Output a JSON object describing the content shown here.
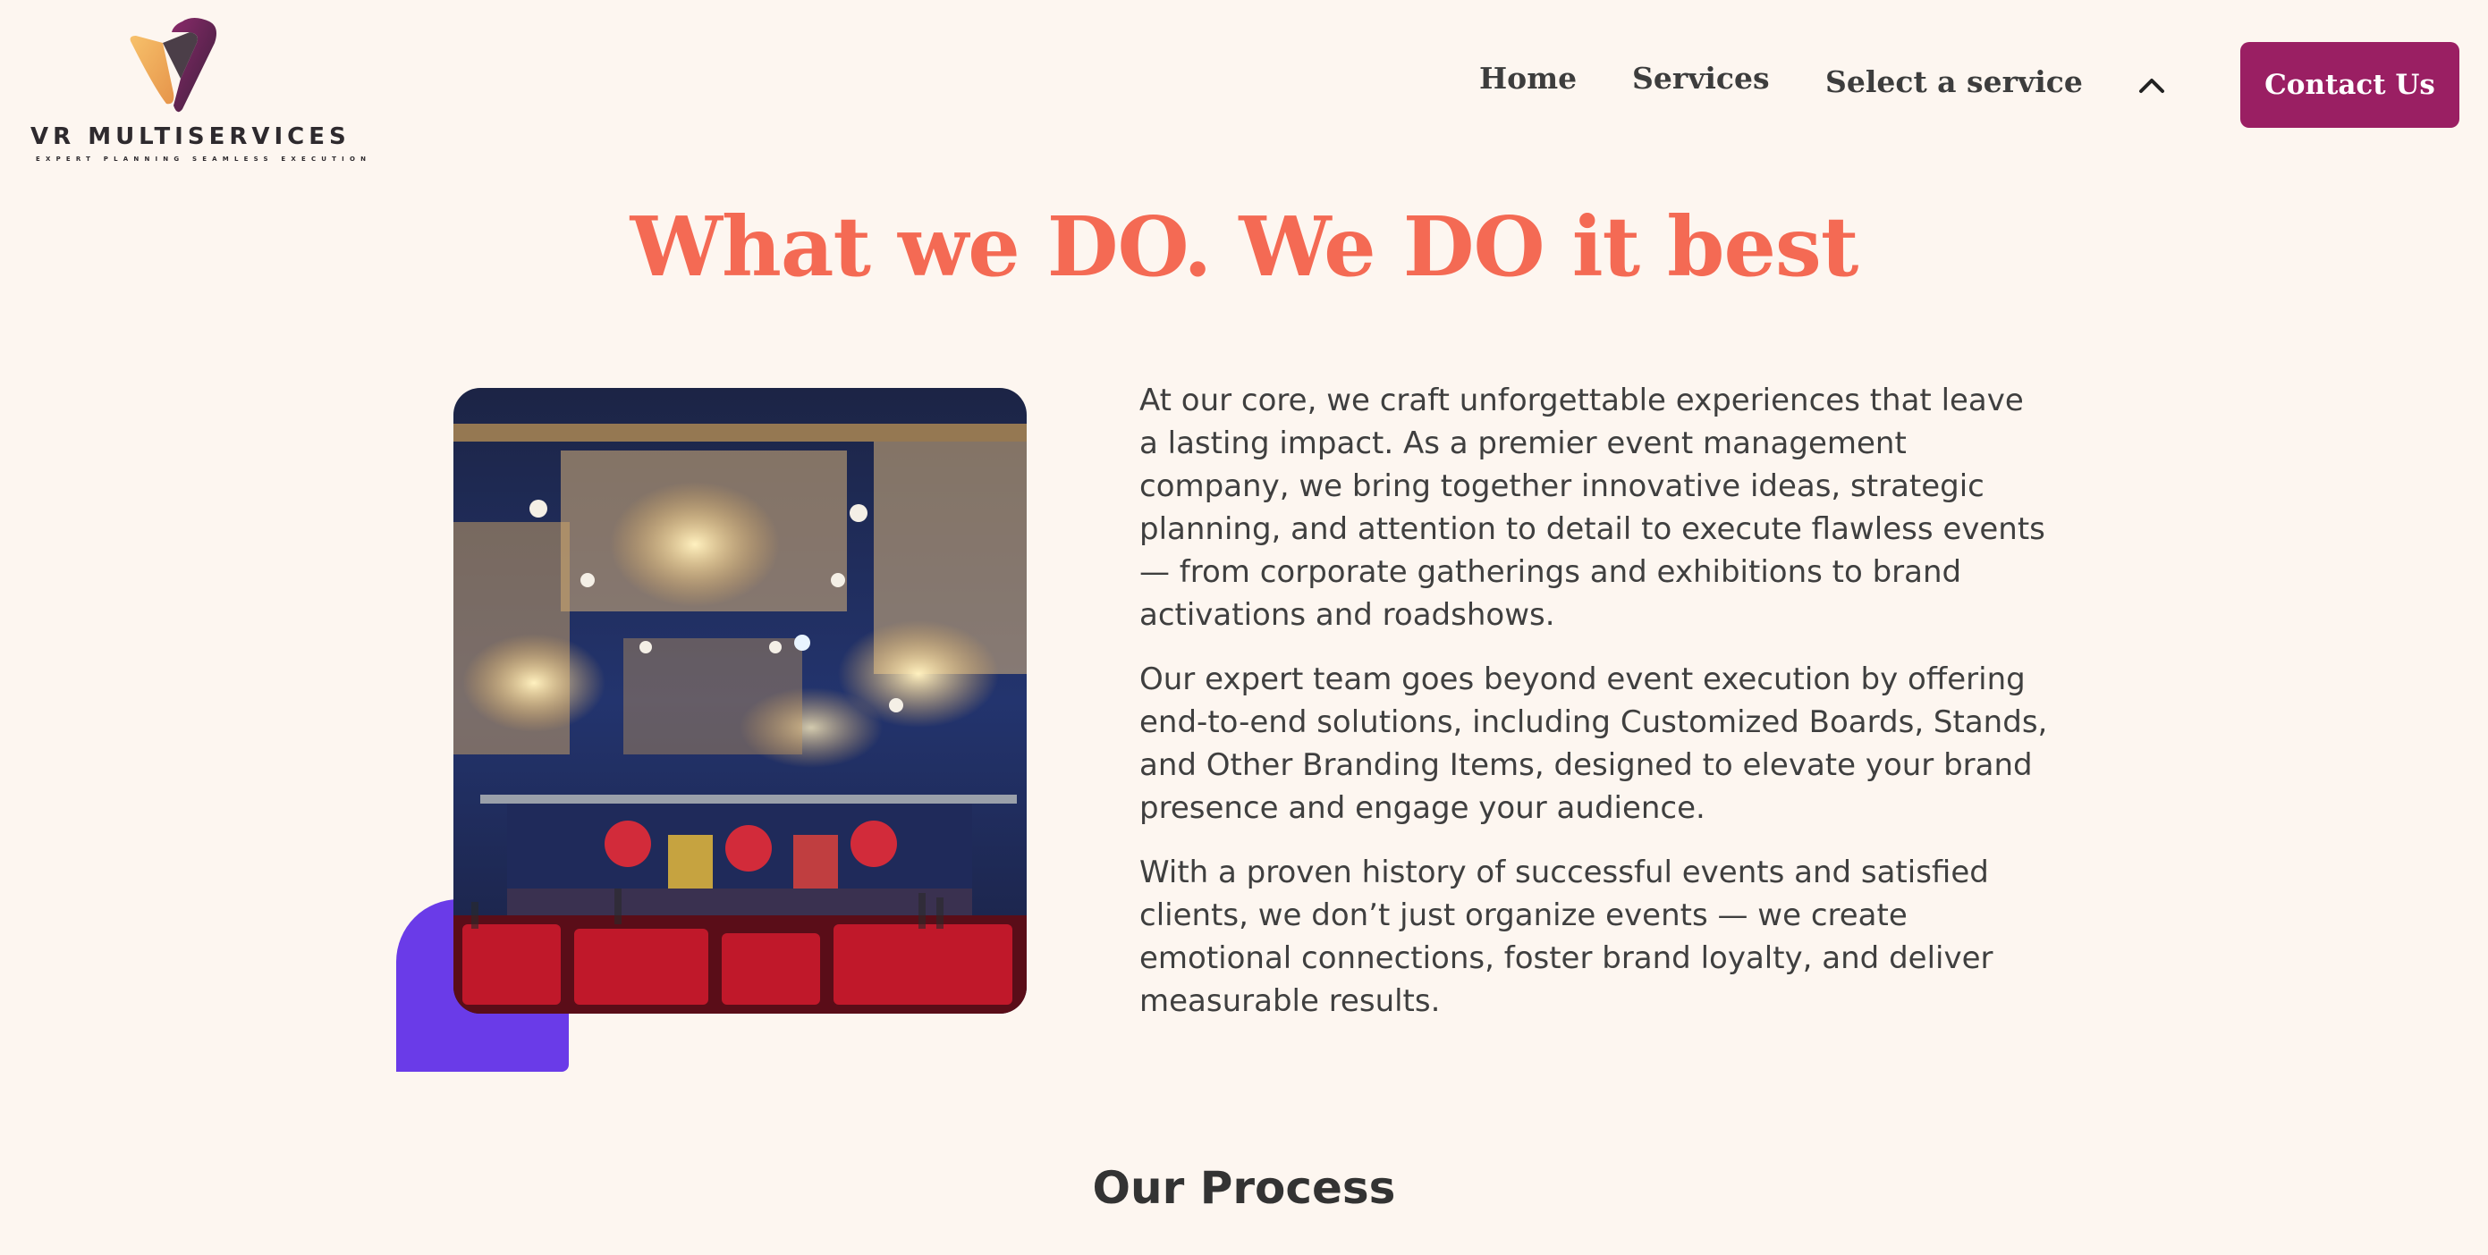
{
  "header": {
    "brand_name": "VR MULTISERVICES",
    "tagline": "EXPERT PLANNING SEAMLESS EXECUTION",
    "nav": {
      "home": "Home",
      "services": "Services",
      "select_service": "Select a service"
    },
    "contact_label": "Contact Us",
    "icons": {
      "logo": "vr-logo-mark",
      "dropdown": "chevron-up-icon"
    },
    "colors": {
      "contact_bg": "#9a1f63"
    }
  },
  "hero": {
    "title": "What we DO. We DO it best",
    "title_color": "#f46a54"
  },
  "about": {
    "image_alt": "Decorated event hall with chandeliers, stage and red seating",
    "paragraphs": [
      "At our core, we craft unforgettable experiences that leave a lasting impact. As a premier event management company, we bring together innovative ideas, strategic planning, and attention to detail to execute flawless events — from corporate gatherings and exhibitions to brand activations and roadshows.",
      "Our expert team goes beyond event execution by offering end-to-end solutions, including Customized Boards, Stands, and Other Branding Items, designed to elevate your brand presence and engage your audience.",
      "With a proven history of successful events and satisfied clients, we don’t just organize events — we create emotional connections, foster brand loyalty, and deliver measurable results."
    ],
    "accent_color": "#6a3be8"
  },
  "process": {
    "title": "Our Process"
  }
}
